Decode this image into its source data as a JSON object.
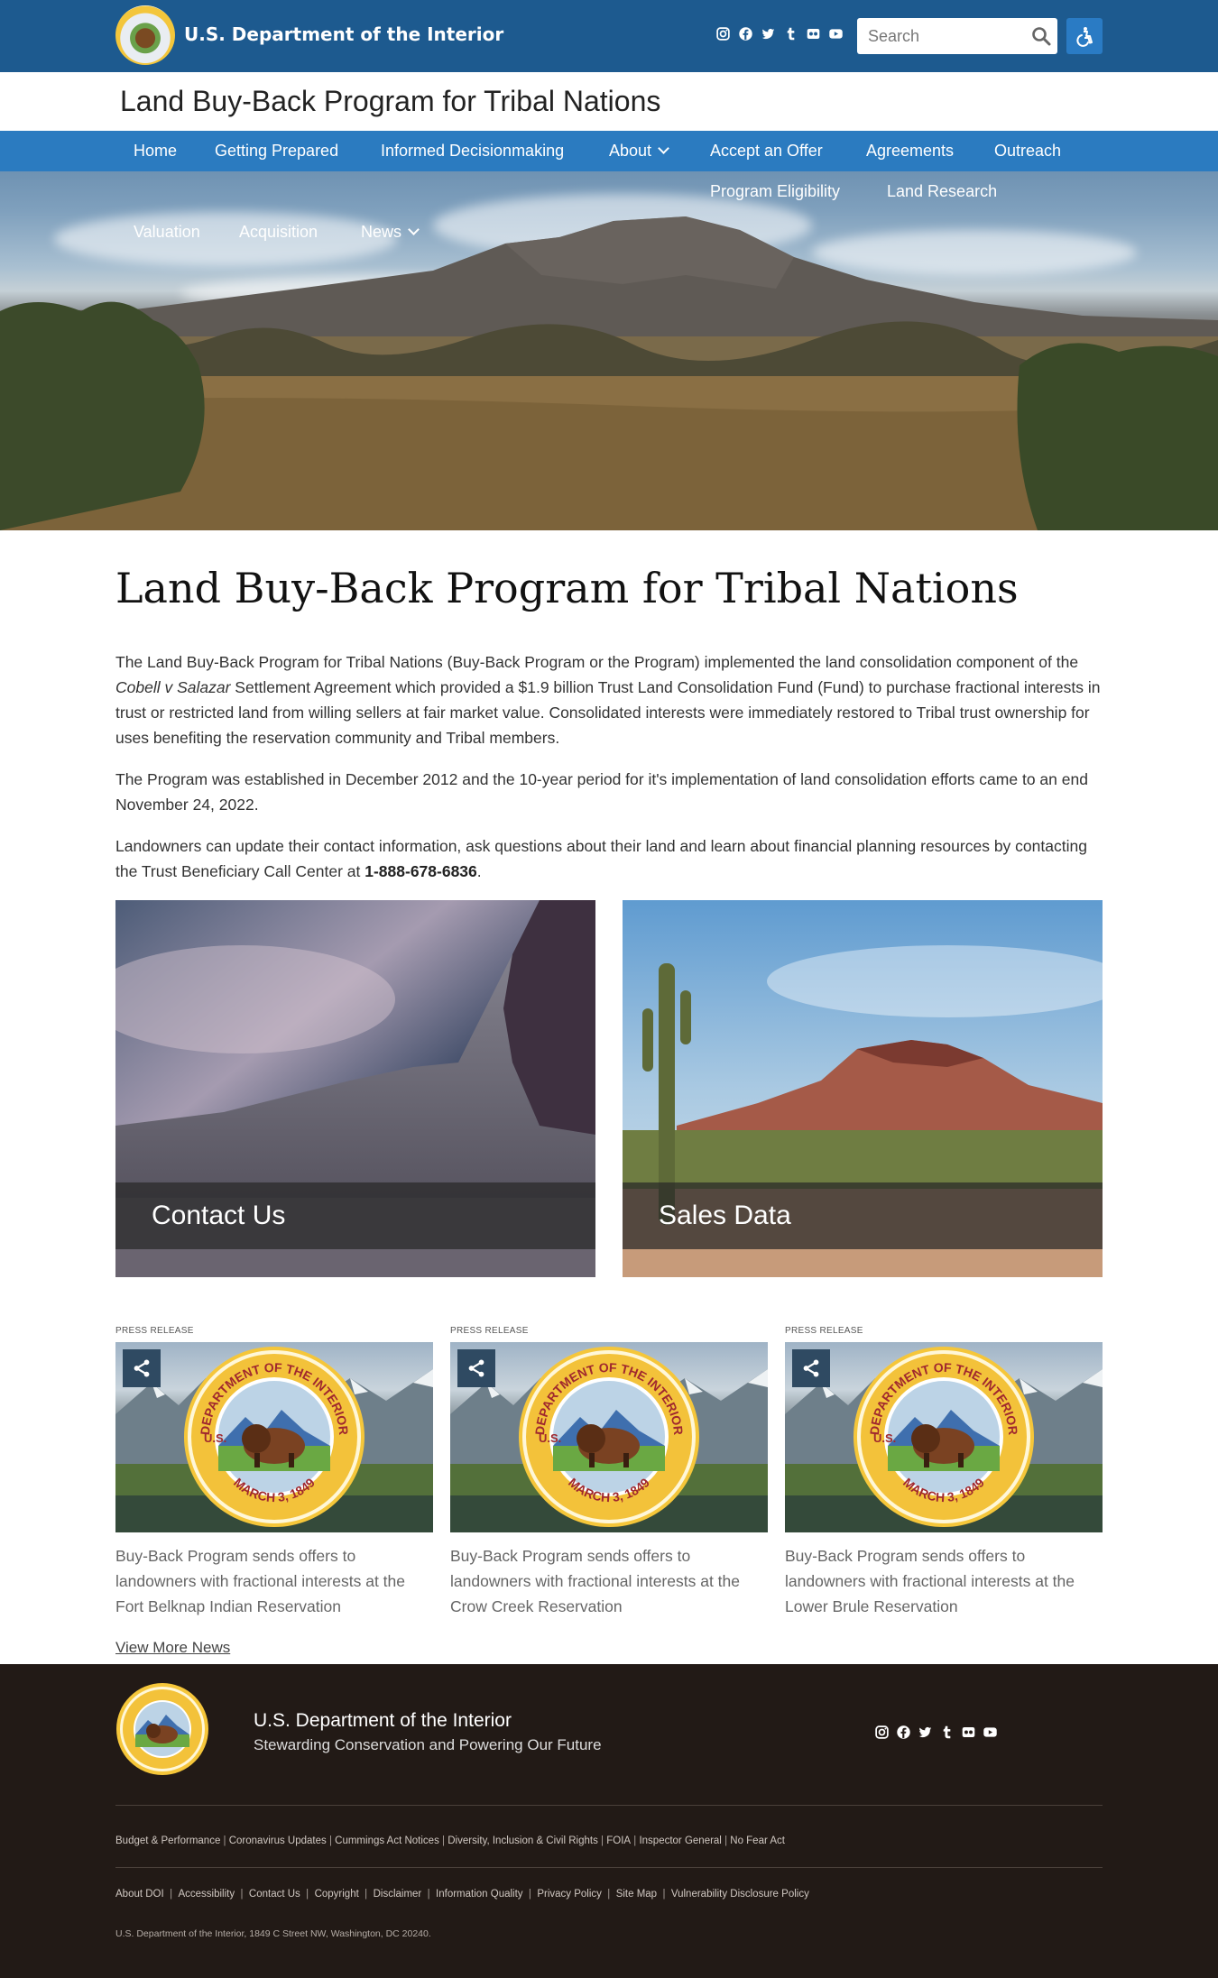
{
  "header": {
    "dept_name": "U.S. Department of the Interior",
    "site_title": "Land Buy-Back Program for Tribal Nations",
    "search_placeholder": "Search",
    "social_icons": [
      "instagram-icon",
      "facebook-icon",
      "twitter-icon",
      "tumblr-icon",
      "flickr-icon",
      "youtube-icon"
    ]
  },
  "nav": {
    "items": [
      "Home",
      "Getting Prepared",
      "Informed Decisionmaking",
      "About",
      "Accept an Offer",
      "Agreements",
      "Outreach",
      "Program Eligibility",
      "Land Research",
      "Valuation",
      "Acquisition",
      "News"
    ]
  },
  "main": {
    "title": "Land Buy-Back Program for Tribal Nations",
    "p1_pre": "The Land Buy-Back Program for Tribal Nations (Buy-Back Program or the Program) implemented the land consolidation component of the ",
    "p1_italic": "Cobell v Salazar",
    "p1_post": " Settlement Agreement which provided a $1.9 billion Trust Land Consolidation Fund (Fund) to purchase fractional interests in trust or restricted land from willing sellers at fair market value. Consolidated interests were immediately restored to Tribal trust ownership for uses benefiting the reservation community and Tribal members.",
    "p2": "The Program was established in December 2012 and the 10-year period for it's implementation of land consolidation efforts came to an end November 24, 2022.",
    "p3_pre": "Landowners can update their contact information, ask questions about their land and learn about financial planning resources by contacting the Trust Beneficiary Call Center at ",
    "p3_phone": "1-888-678-6836",
    "p3_post": ".",
    "cards": [
      "Contact Us",
      "Sales Data"
    ]
  },
  "news": {
    "kicker": "PRESS RELEASE",
    "items": [
      "Buy-Back Program sends offers to landowners with fractional interests at the Fort Belknap Indian Reservation",
      "Buy-Back Program sends offers to landowners with fractional interests at the Crow Creek Reservation",
      "Buy-Back Program sends offers to landowners with fractional interests at the Lower Brule Reservation"
    ],
    "view_more": "View More News",
    "seal_text_top": "DEPARTMENT OF THE INTERIOR",
    "seal_text_left": "U.S.",
    "seal_text_bottom": "MARCH 3, 1849"
  },
  "footer": {
    "dept_name": "U.S. Department of the Interior",
    "tagline": "Stewarding Conservation and Powering Our Future",
    "links_row1": [
      "Budget & Performance",
      "Coronavirus Updates",
      "Cummings Act Notices",
      "Diversity, Inclusion & Civil Rights",
      "FOIA",
      "Inspector General",
      "No Fear Act"
    ],
    "links_row2": [
      "About DOI",
      "Accessibility",
      "Contact Us",
      "Copyright",
      "Disclaimer",
      "Information Quality",
      "Privacy Policy",
      "Site Map",
      "Vulnerability Disclosure Policy"
    ],
    "address": "U.S. Department of the Interior, 1849 C Street NW, Washington, DC 20240."
  },
  "colors": {
    "topbar": "#1d5a8f",
    "nav": "#2b7bc0",
    "footer": "#221a16"
  }
}
